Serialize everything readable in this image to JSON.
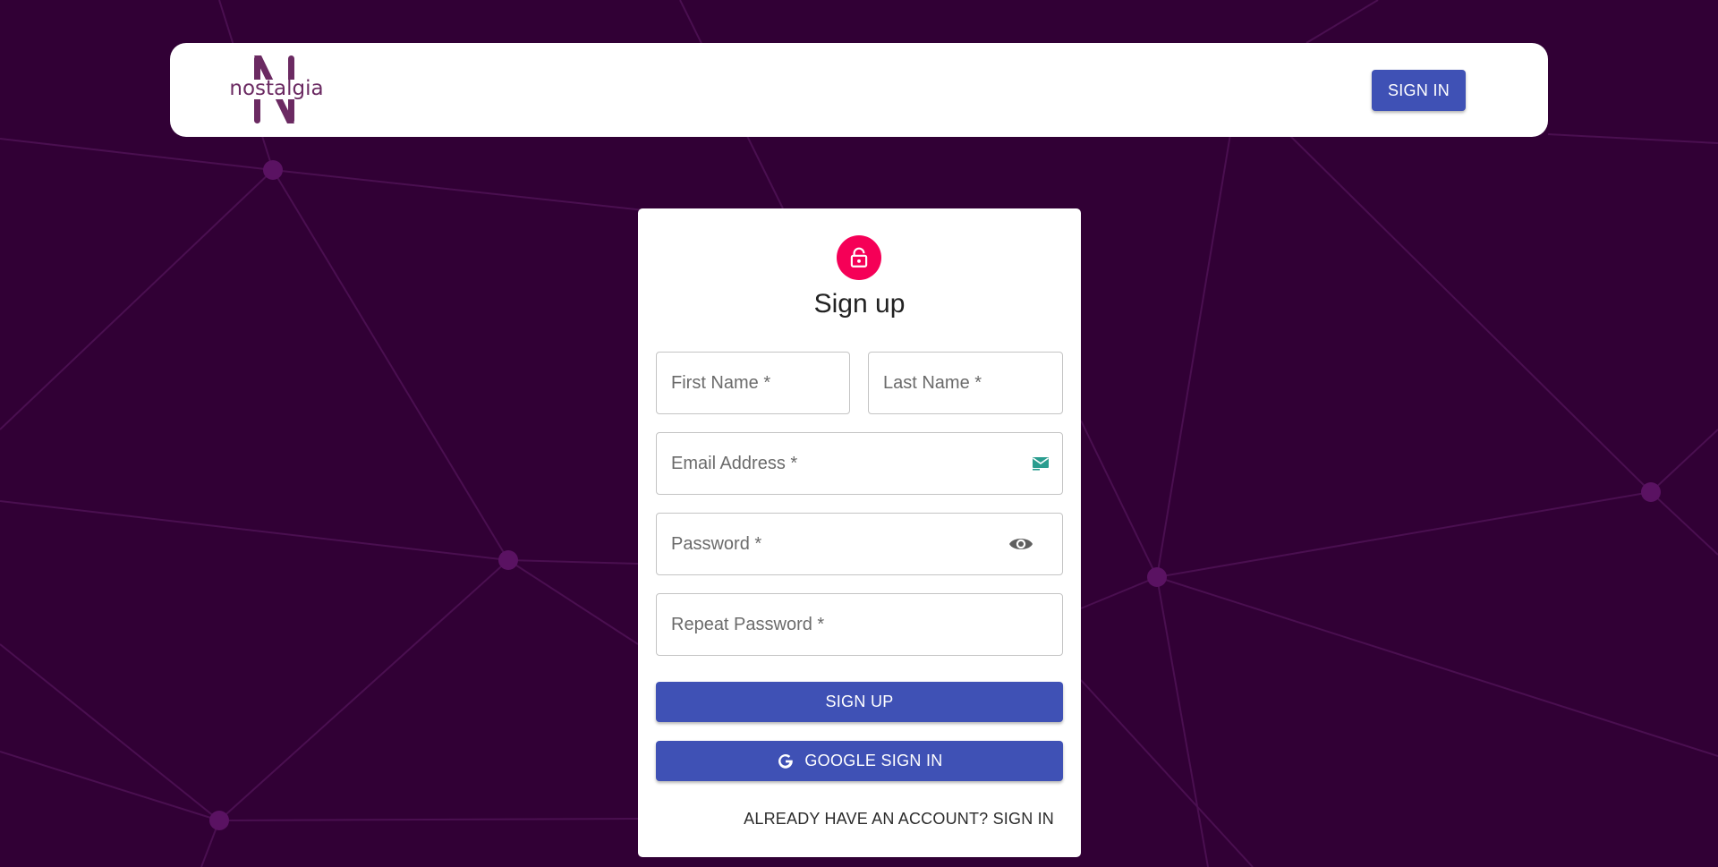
{
  "header": {
    "logo_text": "nostalgia",
    "signin_label": "SIGN IN"
  },
  "form": {
    "title": "Sign up",
    "lock_icon": "lock-icon",
    "fields": {
      "first_name": {
        "placeholder": "First Name *",
        "value": ""
      },
      "last_name": {
        "placeholder": "Last Name *",
        "value": ""
      },
      "email": {
        "placeholder": "Email Address *",
        "value": "",
        "icon": "email-icon"
      },
      "password": {
        "placeholder": "Password *",
        "value": "",
        "icon": "eye-icon"
      },
      "repeat_password": {
        "placeholder": "Repeat Password *",
        "value": ""
      }
    },
    "signup_label": "SIGN UP",
    "google_label": "GOOGLE SIGN IN",
    "google_icon": "google-g-icon",
    "already_label": "ALREADY HAVE AN ACCOUNT? SIGN IN"
  },
  "colors": {
    "background": "#310035",
    "primary": "#3f51b5",
    "accent": "#f50057",
    "logo": "#6b2a62",
    "network_lines": "#4e1052"
  }
}
